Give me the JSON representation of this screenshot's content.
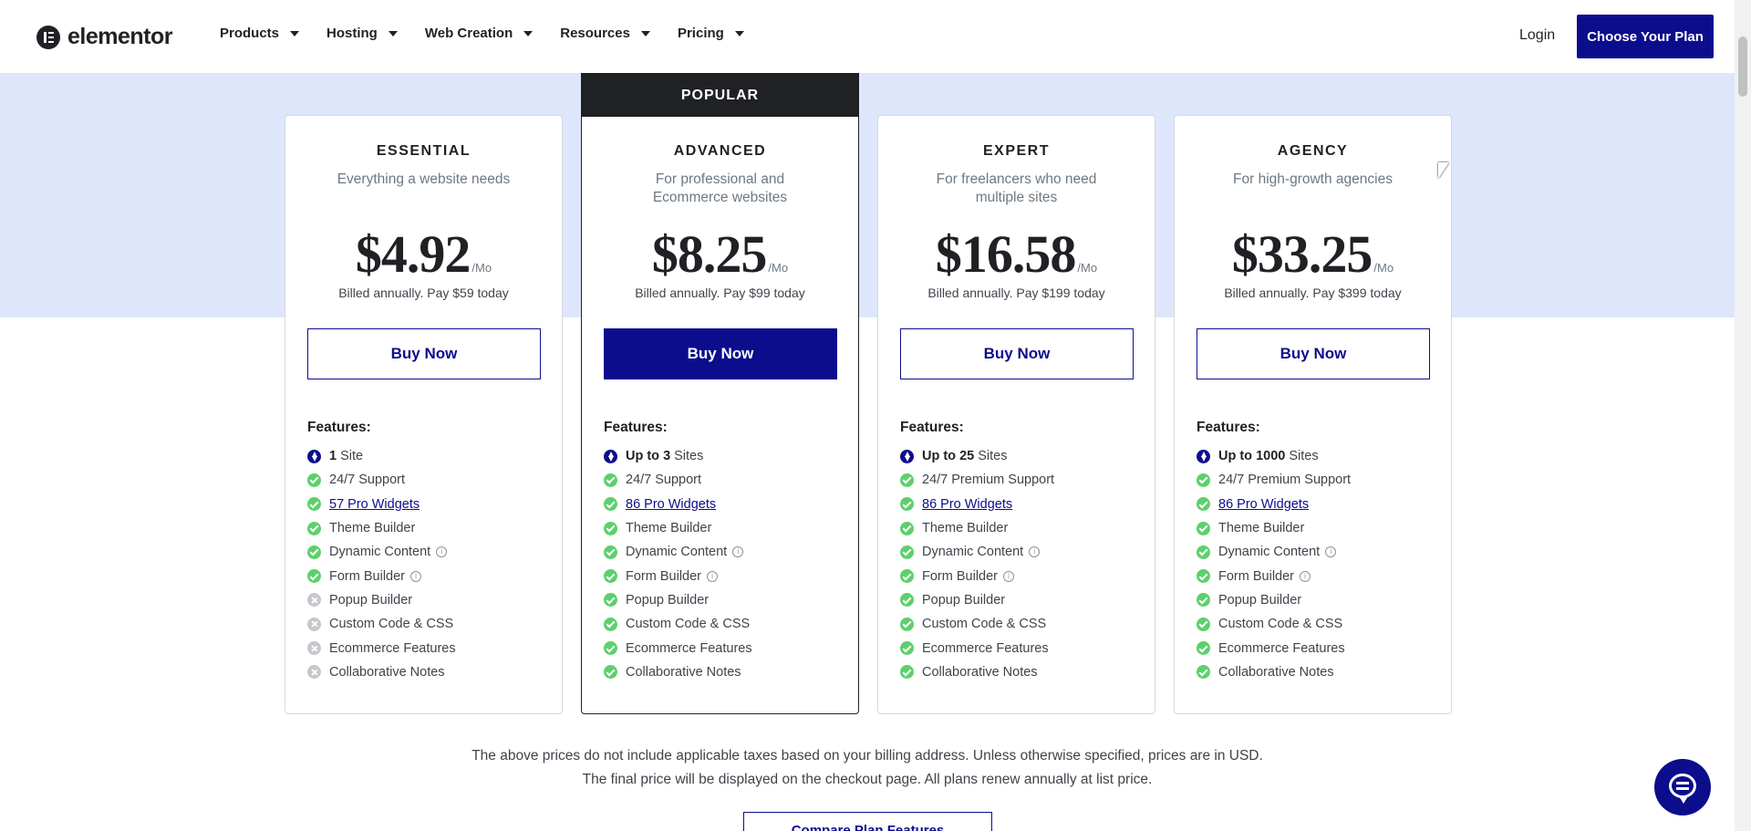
{
  "header": {
    "logo_text": "elementor",
    "nav": [
      {
        "label": "Products"
      },
      {
        "label": "Hosting"
      },
      {
        "label": "Web Creation"
      },
      {
        "label": "Resources"
      },
      {
        "label": "Pricing"
      }
    ],
    "login_label": "Login",
    "cta_label": "Choose Your Plan"
  },
  "plans": [
    {
      "name": "ESSENTIAL",
      "description": "Everything a website needs",
      "price": "$4.92",
      "per": "/Mo",
      "billed": "Billed annually. Pay $59 today",
      "button_label": "Buy Now",
      "features_title": "Features:",
      "features": [
        {
          "icon": "bolt-icon",
          "strong": "1",
          "text": "Site"
        },
        {
          "icon": "check-icon",
          "text": "24/7 Support"
        },
        {
          "icon": "check-icon",
          "link": "57 Pro Widgets"
        },
        {
          "icon": "check-icon",
          "text": "Theme Builder"
        },
        {
          "icon": "check-icon",
          "text": "Dynamic Content",
          "info": "i"
        },
        {
          "icon": "check-icon",
          "text": "Form Builder",
          "info": "i"
        },
        {
          "icon": "cross-icon",
          "text": "Popup Builder"
        },
        {
          "icon": "cross-icon",
          "text": "Custom Code & CSS"
        },
        {
          "icon": "cross-icon",
          "text": "Ecommerce Features"
        },
        {
          "icon": "cross-icon",
          "text": "Collaborative Notes"
        }
      ]
    },
    {
      "name": "ADVANCED",
      "badge": "POPULAR",
      "description": "For professional and Ecommerce websites",
      "price": "$8.25",
      "per": "/Mo",
      "billed": "Billed annually. Pay $99 today",
      "button_label": "Buy Now",
      "features_title": "Features:",
      "features": [
        {
          "icon": "bolt-icon",
          "strong": "Up to 3",
          "text": "Sites"
        },
        {
          "icon": "check-icon",
          "text": "24/7 Support"
        },
        {
          "icon": "check-icon",
          "link": "86 Pro Widgets"
        },
        {
          "icon": "check-icon",
          "text": "Theme Builder"
        },
        {
          "icon": "check-icon",
          "text": "Dynamic Content",
          "info": "i"
        },
        {
          "icon": "check-icon",
          "text": "Form Builder",
          "info": "i"
        },
        {
          "icon": "check-icon",
          "text": "Popup Builder"
        },
        {
          "icon": "check-icon",
          "text": "Custom Code & CSS"
        },
        {
          "icon": "check-icon",
          "text": "Ecommerce Features"
        },
        {
          "icon": "check-icon",
          "text": "Collaborative Notes"
        }
      ]
    },
    {
      "name": "EXPERT",
      "description": "For freelancers who need multiple sites",
      "price": "$16.58",
      "per": "/Mo",
      "billed": "Billed annually. Pay $199 today",
      "button_label": "Buy Now",
      "features_title": "Features:",
      "features": [
        {
          "icon": "bolt-icon",
          "strong": "Up to 25",
          "text": "Sites"
        },
        {
          "icon": "check-icon",
          "text": "24/7 Premium Support"
        },
        {
          "icon": "check-icon",
          "link": "86 Pro Widgets"
        },
        {
          "icon": "check-icon",
          "text": "Theme Builder"
        },
        {
          "icon": "check-icon",
          "text": "Dynamic Content",
          "info": "i"
        },
        {
          "icon": "check-icon",
          "text": "Form Builder",
          "info": "i"
        },
        {
          "icon": "check-icon",
          "text": "Popup Builder"
        },
        {
          "icon": "check-icon",
          "text": "Custom Code & CSS"
        },
        {
          "icon": "check-icon",
          "text": "Ecommerce Features"
        },
        {
          "icon": "check-icon",
          "text": "Collaborative Notes"
        }
      ]
    },
    {
      "name": "AGENCY",
      "description": "For high-growth agencies",
      "price": "$33.25",
      "per": "/Mo",
      "billed": "Billed annually. Pay $399 today",
      "button_label": "Buy Now",
      "features_title": "Features:",
      "features": [
        {
          "icon": "bolt-icon",
          "strong": "Up to 1000",
          "text": "Sites"
        },
        {
          "icon": "check-icon",
          "text": "24/7 Premium Support"
        },
        {
          "icon": "check-icon",
          "link": "86 Pro Widgets"
        },
        {
          "icon": "check-icon",
          "text": "Theme Builder"
        },
        {
          "icon": "check-icon",
          "text": "Dynamic Content",
          "info": "i"
        },
        {
          "icon": "check-icon",
          "text": "Form Builder",
          "info": "i"
        },
        {
          "icon": "check-icon",
          "text": "Popup Builder"
        },
        {
          "icon": "check-icon",
          "text": "Custom Code & CSS"
        },
        {
          "icon": "check-icon",
          "text": "Ecommerce Features"
        },
        {
          "icon": "check-icon",
          "text": "Collaborative Notes"
        }
      ]
    }
  ],
  "disclaimer": {
    "line1": "The above prices do not include applicable taxes based on your billing address. Unless otherwise specified, prices are in USD.",
    "line2": "The final price will be displayed on the checkout page. All plans renew annually at list price."
  },
  "compare_label": "Compare Plan Features",
  "colors": {
    "brand": "#0c0d8d",
    "band": "#dde6fb",
    "check": "#5dd06b",
    "cross": "#c5c8cc",
    "dark": "#1f2124"
  }
}
